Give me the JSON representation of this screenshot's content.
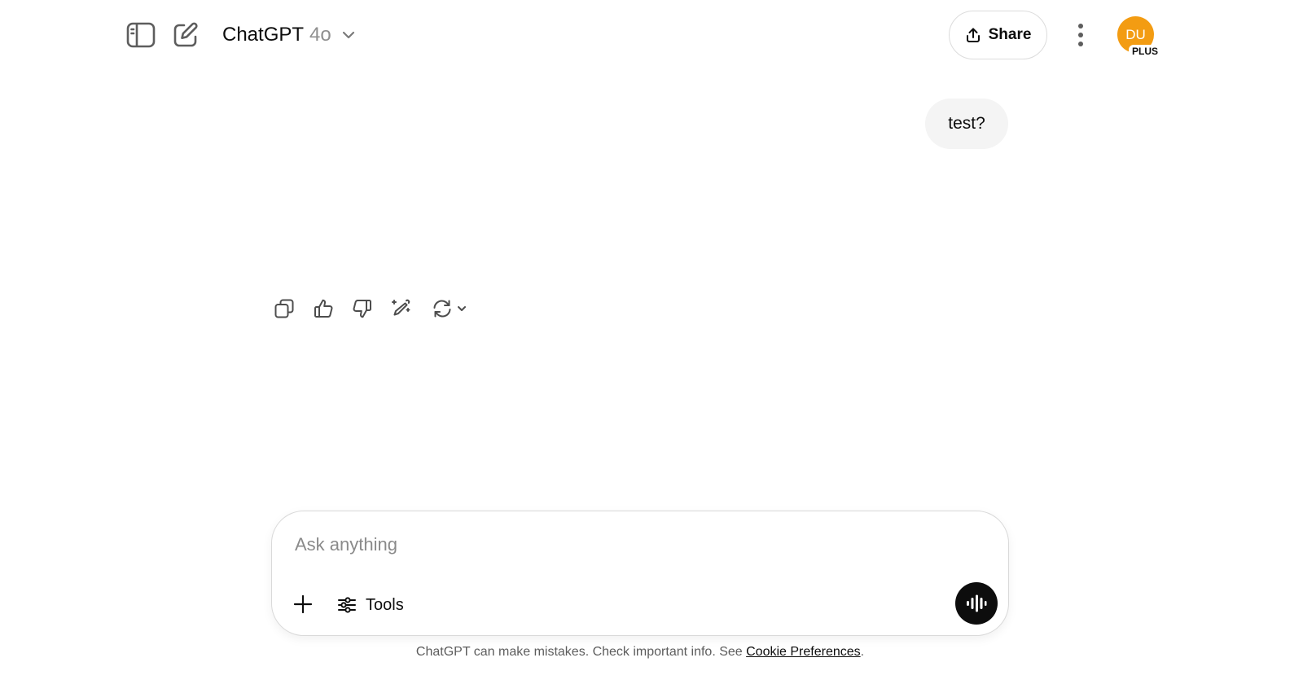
{
  "header": {
    "title": "ChatGPT",
    "model": "4o",
    "share_label": "Share",
    "avatar_initials": "DU",
    "plan_badge": "PLUS",
    "avatar_color": "#f39c12"
  },
  "conversation": {
    "user_message": "test?"
  },
  "message_actions": [
    "copy-icon",
    "thumbs-up-icon",
    "thumbs-down-icon",
    "edit-in-canvas-icon",
    "regenerate-icon"
  ],
  "composer": {
    "placeholder": "Ask anything",
    "value": "",
    "tools_label": "Tools"
  },
  "footer": {
    "disclaimer": "ChatGPT can make mistakes. Check important info. See ",
    "link_label": "Cookie Preferences",
    "suffix": "."
  }
}
